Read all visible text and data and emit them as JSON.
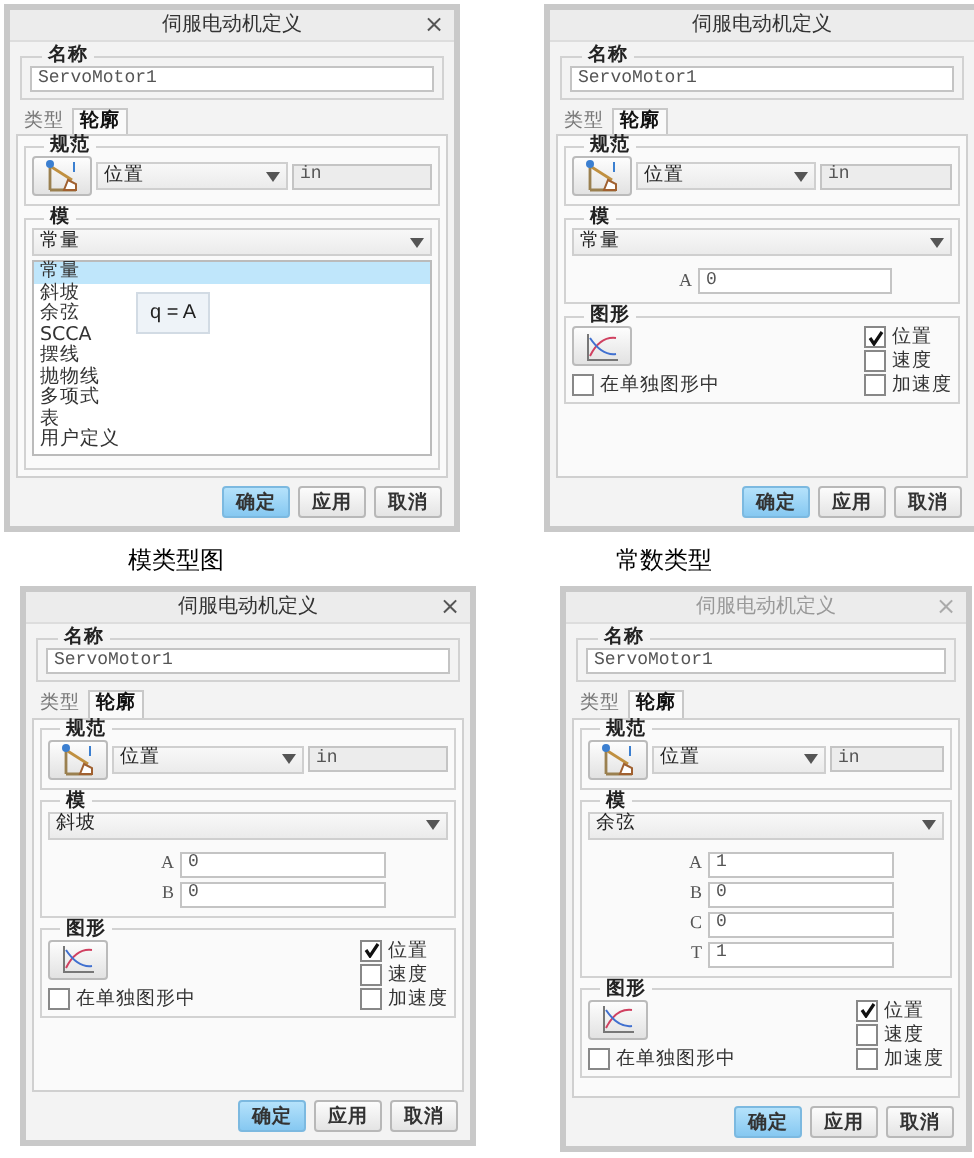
{
  "dialogs": [
    {
      "title": "伺服电动机定义",
      "close": "×",
      "active": true,
      "name_label": "名称",
      "name_value": "ServoMotor1",
      "tabs": [
        {
          "label": "类型",
          "selected": false
        },
        {
          "label": "轮廓",
          "selected": true
        }
      ],
      "spec": {
        "label": "规范",
        "quantity": "位置",
        "unit": "in"
      },
      "model": {
        "label": "模",
        "value": "常量",
        "options": [
          {
            "label": "常量",
            "selected": true
          },
          {
            "label": "斜坡",
            "selected": false
          },
          {
            "label": "余弦",
            "selected": false
          },
          {
            "label": "SCCA",
            "selected": false
          },
          {
            "label": "摆线",
            "selected": false
          },
          {
            "label": "抛物线",
            "selected": false
          },
          {
            "label": "多项式",
            "selected": false
          },
          {
            "label": "表",
            "selected": false
          },
          {
            "label": "用户定义",
            "selected": false
          }
        ],
        "tooltip": "q = A"
      },
      "buttons": [
        {
          "label": "确定",
          "primary": true
        },
        {
          "label": "应用",
          "primary": false
        },
        {
          "label": "取消",
          "primary": false
        }
      ],
      "caption": "模类型图"
    },
    {
      "title": "伺服电动机定义",
      "active": true,
      "name_label": "名称",
      "name_value": "ServoMotor1",
      "tabs": [
        {
          "label": "类型",
          "selected": false
        },
        {
          "label": "轮廓",
          "selected": true
        }
      ],
      "spec": {
        "label": "规范",
        "quantity": "位置",
        "unit": "in"
      },
      "model": {
        "label": "模",
        "value": "常量",
        "params": [
          {
            "label": "A",
            "value": "0"
          }
        ]
      },
      "graph": {
        "label": "图形",
        "separate": {
          "label": "在单独图形中",
          "checked": false
        },
        "plots": [
          {
            "label": "位置",
            "checked": true
          },
          {
            "label": "速度",
            "checked": false
          },
          {
            "label": "加速度",
            "checked": false
          }
        ]
      },
      "buttons": [
        {
          "label": "确定",
          "primary": true
        },
        {
          "label": "应用",
          "primary": false
        },
        {
          "label": "取消",
          "primary": false
        }
      ],
      "caption": "常数类型"
    },
    {
      "title": "伺服电动机定义",
      "close": "×",
      "active": true,
      "name_label": "名称",
      "name_value": "ServoMotor1",
      "tabs": [
        {
          "label": "类型",
          "selected": false
        },
        {
          "label": "轮廓",
          "selected": true
        }
      ],
      "spec": {
        "label": "规范",
        "quantity": "位置",
        "unit": "in"
      },
      "model": {
        "label": "模",
        "value": "斜坡",
        "params": [
          {
            "label": "A",
            "value": "0"
          },
          {
            "label": "B",
            "value": "0"
          }
        ]
      },
      "graph": {
        "label": "图形",
        "separate": {
          "label": "在单独图形中",
          "checked": false
        },
        "plots": [
          {
            "label": "位置",
            "checked": true
          },
          {
            "label": "速度",
            "checked": false
          },
          {
            "label": "加速度",
            "checked": false
          }
        ]
      },
      "buttons": [
        {
          "label": "确定",
          "primary": true
        },
        {
          "label": "应用",
          "primary": false
        },
        {
          "label": "取消",
          "primary": false
        }
      ]
    },
    {
      "title": "伺服电动机定义",
      "close": "×",
      "active": false,
      "name_label": "名称",
      "name_value": "ServoMotor1",
      "tabs": [
        {
          "label": "类型",
          "selected": false
        },
        {
          "label": "轮廓",
          "selected": true
        }
      ],
      "spec": {
        "label": "规范",
        "quantity": "位置",
        "unit": "in"
      },
      "model": {
        "label": "模",
        "value": "余弦",
        "params": [
          {
            "label": "A",
            "value": "1"
          },
          {
            "label": "B",
            "value": "0"
          },
          {
            "label": "C",
            "value": "0"
          },
          {
            "label": "T",
            "value": "1"
          }
        ]
      },
      "graph": {
        "label": "图形",
        "separate": {
          "label": "在单独图形中",
          "checked": false
        },
        "plots": [
          {
            "label": "位置",
            "checked": true
          },
          {
            "label": "速度",
            "checked": false
          },
          {
            "label": "加速度",
            "checked": false
          }
        ]
      },
      "buttons": [
        {
          "label": "确定",
          "primary": true
        },
        {
          "label": "应用",
          "primary": false
        },
        {
          "label": "取消",
          "primary": false
        }
      ]
    }
  ]
}
